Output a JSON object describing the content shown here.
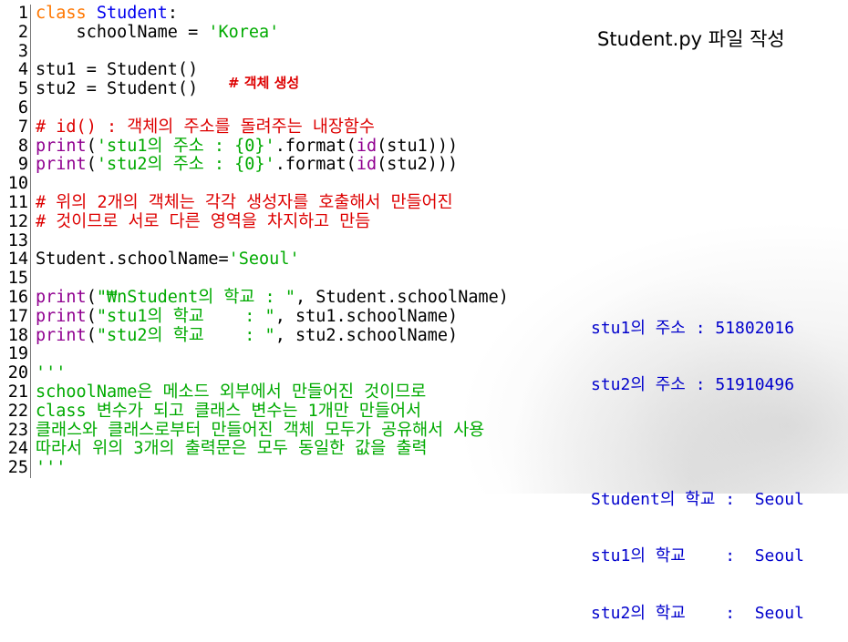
{
  "title": "Student.py 파일 작성",
  "annotation": "# 객체 생성",
  "code_lines": [
    {
      "n": "1"
    },
    {
      "n": "2"
    },
    {
      "n": "3"
    },
    {
      "n": "4"
    },
    {
      "n": "5"
    },
    {
      "n": "6"
    },
    {
      "n": "7"
    },
    {
      "n": "8"
    },
    {
      "n": "9"
    },
    {
      "n": "10"
    },
    {
      "n": "11"
    },
    {
      "n": "12"
    },
    {
      "n": "13"
    },
    {
      "n": "14"
    },
    {
      "n": "15"
    },
    {
      "n": "16"
    },
    {
      "n": "17"
    },
    {
      "n": "18"
    },
    {
      "n": "19"
    },
    {
      "n": "20"
    },
    {
      "n": "21"
    },
    {
      "n": "22"
    },
    {
      "n": "23"
    },
    {
      "n": "24"
    },
    {
      "n": "25"
    }
  ],
  "code": {
    "l1_kw": "class",
    "l1_name": " Student",
    "l1_colon": ":",
    "l2_var": "    schoolName = ",
    "l2_str": "'Korea'",
    "l4": "stu1 = Student()",
    "l5": "stu2 = Student()",
    "l7": "# id() : 객체의 주소를 돌려주는 내장함수",
    "l8_print": "print",
    "l8_a": "(",
    "l8_str": "'stu1의 주소 : {0}'",
    "l8_b": ".format(",
    "l8_id": "id",
    "l8_c": "(stu1)))",
    "l9_print": "print",
    "l9_a": "(",
    "l9_str": "'stu2의 주소 : {0}'",
    "l9_b": ".format(",
    "l9_id": "id",
    "l9_c": "(stu2)))",
    "l11": "# 위의 2개의 객체는 각각 생성자를 호출해서 만들어진",
    "l12": "# 것이므로 서로 다른 영역을 차지하고 만듬",
    "l14_a": "Student.schoolName=",
    "l14_str": "'Seoul'",
    "l16_print": "print",
    "l16_a": "(",
    "l16_str": "\"₩nStudent의 학교 : \"",
    "l16_b": ", Student.schoolName)",
    "l17_print": "print",
    "l17_a": "(",
    "l17_str": "\"stu1의 학교    : \"",
    "l17_b": ", stu1.schoolName)",
    "l18_print": "print",
    "l18_a": "(",
    "l18_str": "\"stu2의 학교    : \"",
    "l18_b": ", stu2.schoolName)",
    "l20": "'''",
    "l21": "schoolName은 메소드 외부에서 만들어진 것이므로",
    "l22": "class 변수가 되고 클래스 변수는 1개만 만들어서",
    "l23": "클래스와 클래스로부터 만들어진 객체 모두가 공유해서 사용",
    "l24": "따라서 위의 3개의 출력문은 모두 동일한 값을 출력",
    "l25": "'''"
  },
  "output": {
    "line1": "stu1의 주소 : 51802016",
    "line2": "stu2의 주소 : 51910496",
    "line3": "Student의 학교 :  Seoul",
    "line4": "stu1의 학교    :  Seoul",
    "line5": "stu2의 학교    :  Seoul"
  }
}
